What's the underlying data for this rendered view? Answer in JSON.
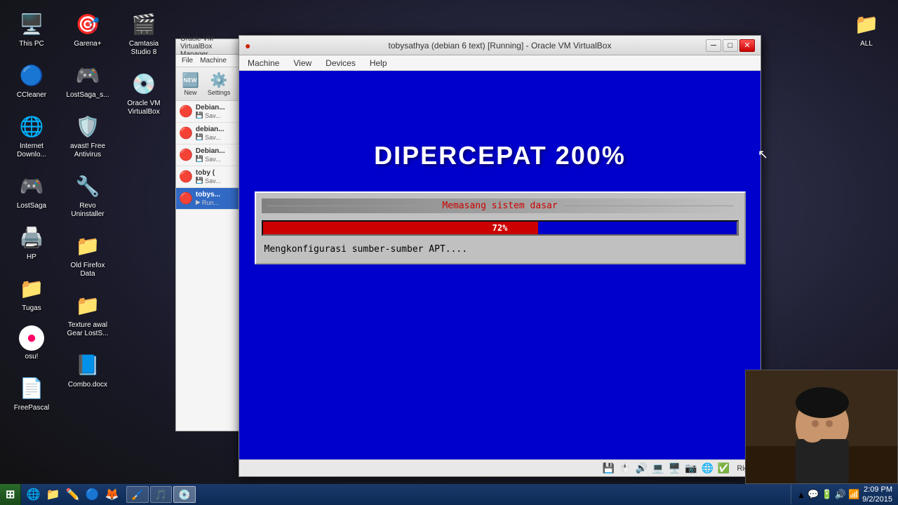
{
  "desktop": {
    "background": "#2c2c3e"
  },
  "icons": [
    {
      "id": "this-pc",
      "label": "This PC",
      "emoji": "🖥️"
    },
    {
      "id": "ccleaner",
      "label": "CCleaner",
      "emoji": "🔵"
    },
    {
      "id": "internet-download",
      "label": "Internet Downlo...",
      "emoji": "🌐"
    },
    {
      "id": "lostsaga",
      "label": "LostSaga",
      "emoji": "🎮"
    },
    {
      "id": "hp",
      "label": "HP",
      "emoji": "🖨️"
    },
    {
      "id": "tugas",
      "label": "Tugas",
      "emoji": "📁"
    },
    {
      "id": "osul",
      "label": "osu!",
      "emoji": "🔴"
    },
    {
      "id": "free-pascal",
      "label": "FreePascal",
      "emoji": "📄"
    },
    {
      "id": "garena-plus",
      "label": "Garena+",
      "emoji": "🎯"
    },
    {
      "id": "lostsaga-s",
      "label": "LostSaga_s...",
      "emoji": "🎮"
    },
    {
      "id": "avast",
      "label": "avast! Free Antivirus",
      "emoji": "🛡️"
    },
    {
      "id": "revo",
      "label": "Revo Uninstaller",
      "emoji": "🔧"
    },
    {
      "id": "old-firefox",
      "label": "Old Firefox Data",
      "emoji": "📁"
    },
    {
      "id": "texture-awal",
      "label": "Texture awal Gear LostS...",
      "emoji": "📁"
    },
    {
      "id": "combo-docx",
      "label": "Combo.docx",
      "emoji": "📘"
    },
    {
      "id": "camtasia",
      "label": "Camtasia Studio 8",
      "emoji": "🎬"
    },
    {
      "id": "oracle-vm",
      "label": "Oracle VM VirtualBox",
      "emoji": "💿"
    }
  ],
  "icon_right": {
    "label": "ALL",
    "emoji": "📁"
  },
  "explorer_sidebar": {
    "title": "Oracle VM VirtualBox Manager",
    "menu_items": [
      "File",
      "Machine"
    ],
    "toolbar": [
      {
        "label": "New",
        "emoji": "🆕"
      },
      {
        "label": "Settings",
        "emoji": "⚙️"
      }
    ],
    "vm_list": [
      {
        "name": "Debian...",
        "status": "Sav...",
        "selected": false
      },
      {
        "name": "debian...",
        "status": "Sav...",
        "selected": false
      },
      {
        "name": "Debian...",
        "status": "Sav...",
        "selected": false
      },
      {
        "name": "toby (",
        "status": "Sav...",
        "selected": false
      },
      {
        "name": "tobys...",
        "status": "Run...",
        "selected": true
      }
    ]
  },
  "vbox_window": {
    "title": "tobysathya (debian 6 text) [Running] - Oracle VM VirtualBox",
    "menu_items": [
      "Machine",
      "View",
      "Devices",
      "Help"
    ],
    "vm_display": {
      "main_text": "DIPERCEPAT 200%",
      "progress_dialog": {
        "title": "Memasang sistem dasar",
        "percent": 72,
        "red_width": 58,
        "blue_width": 42,
        "percent_label": "72%",
        "status_text": "Mengkonfigurasi sumber-sumber APT...."
      }
    },
    "status_bar": {
      "right_label": "Right"
    }
  },
  "taskbar": {
    "start_label": "",
    "apps": [
      {
        "label": "Oracle VM VirtualBox",
        "icon": "💿",
        "active": true
      }
    ],
    "tray_icons": [
      "🔼",
      "💬",
      "🔋",
      "🔊",
      "📶"
    ],
    "clock": "2:09 PM\n9/2/2015"
  }
}
